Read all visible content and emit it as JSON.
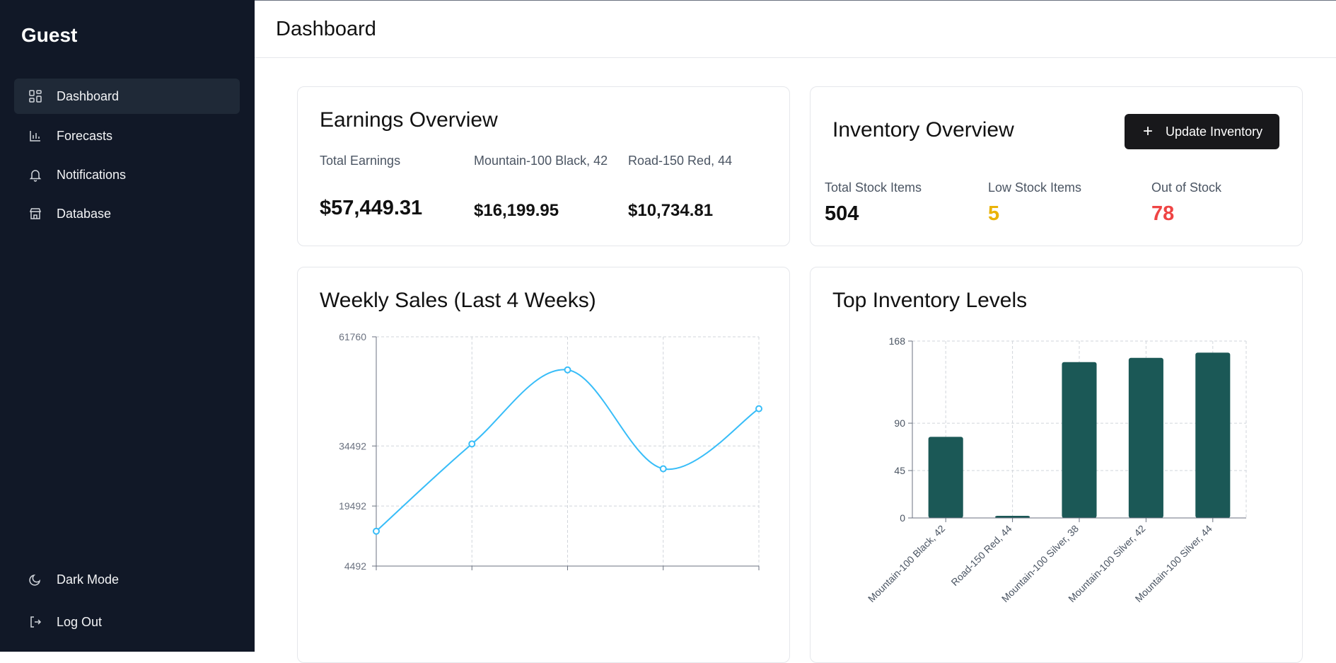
{
  "sidebar": {
    "brand": "Guest",
    "items": [
      {
        "label": "Dashboard",
        "icon": "dashboard-grid-icon",
        "active": true
      },
      {
        "label": "Forecasts",
        "icon": "bar-chart-icon"
      },
      {
        "label": "Notifications",
        "icon": "bell-icon"
      },
      {
        "label": "Database",
        "icon": "store-icon"
      }
    ],
    "bottom": [
      {
        "label": "Dark Mode",
        "icon": "moon-icon"
      },
      {
        "label": "Log Out",
        "icon": "logout-icon"
      }
    ]
  },
  "header": {
    "title": "Dashboard"
  },
  "earnings": {
    "title": "Earnings Overview",
    "total_label": "Total Earnings",
    "total_value": "$57,449.31",
    "item1_label": "Mountain-100 Black, 42",
    "item1_value": "$16,199.95",
    "item2_label": "Road-150 Red, 44",
    "item2_value": "$10,734.81"
  },
  "inventory": {
    "title": "Inventory Overview",
    "button_label": "Update Inventory",
    "total_label": "Total Stock Items",
    "total_value": "504",
    "low_label": "Low Stock Items",
    "low_value": "5",
    "out_label": "Out of Stock",
    "out_value": "78"
  },
  "colors": {
    "sidebar_bg": "#111827",
    "line": "#38bdf8",
    "bar": "#1b5856",
    "low_stock": "#eab308",
    "out_of_stock": "#ef4444"
  },
  "weekly_chart": {
    "title": "Weekly Sales (Last 4 Weeks)"
  },
  "inventory_chart": {
    "title": "Top Inventory Levels"
  },
  "chart_data": [
    {
      "type": "line",
      "title": "Weekly Sales (Last 4 Weeks)",
      "x": [
        "",
        "",
        "",
        "",
        ""
      ],
      "y_ticks": [
        4492,
        19492,
        34492,
        61760
      ],
      "ylim": [
        4492,
        61760
      ],
      "series": [
        {
          "values": [
            13200,
            35000,
            53500,
            28800,
            43800
          ]
        }
      ],
      "grid": true,
      "color": "#38bdf8"
    },
    {
      "type": "bar",
      "title": "Top Inventory Levels",
      "categories": [
        "Mountain-100 Black, 42",
        "Road-150 Red, 44",
        "Mountain-100 Silver, 38",
        "Mountain-100 Silver, 42",
        "Mountain-100 Silver, 44"
      ],
      "values": [
        77,
        2,
        148,
        152,
        157
      ],
      "y_ticks": [
        0,
        45,
        90,
        168
      ],
      "ylim": [
        0,
        168
      ],
      "grid": true,
      "color": "#1b5856"
    }
  ]
}
